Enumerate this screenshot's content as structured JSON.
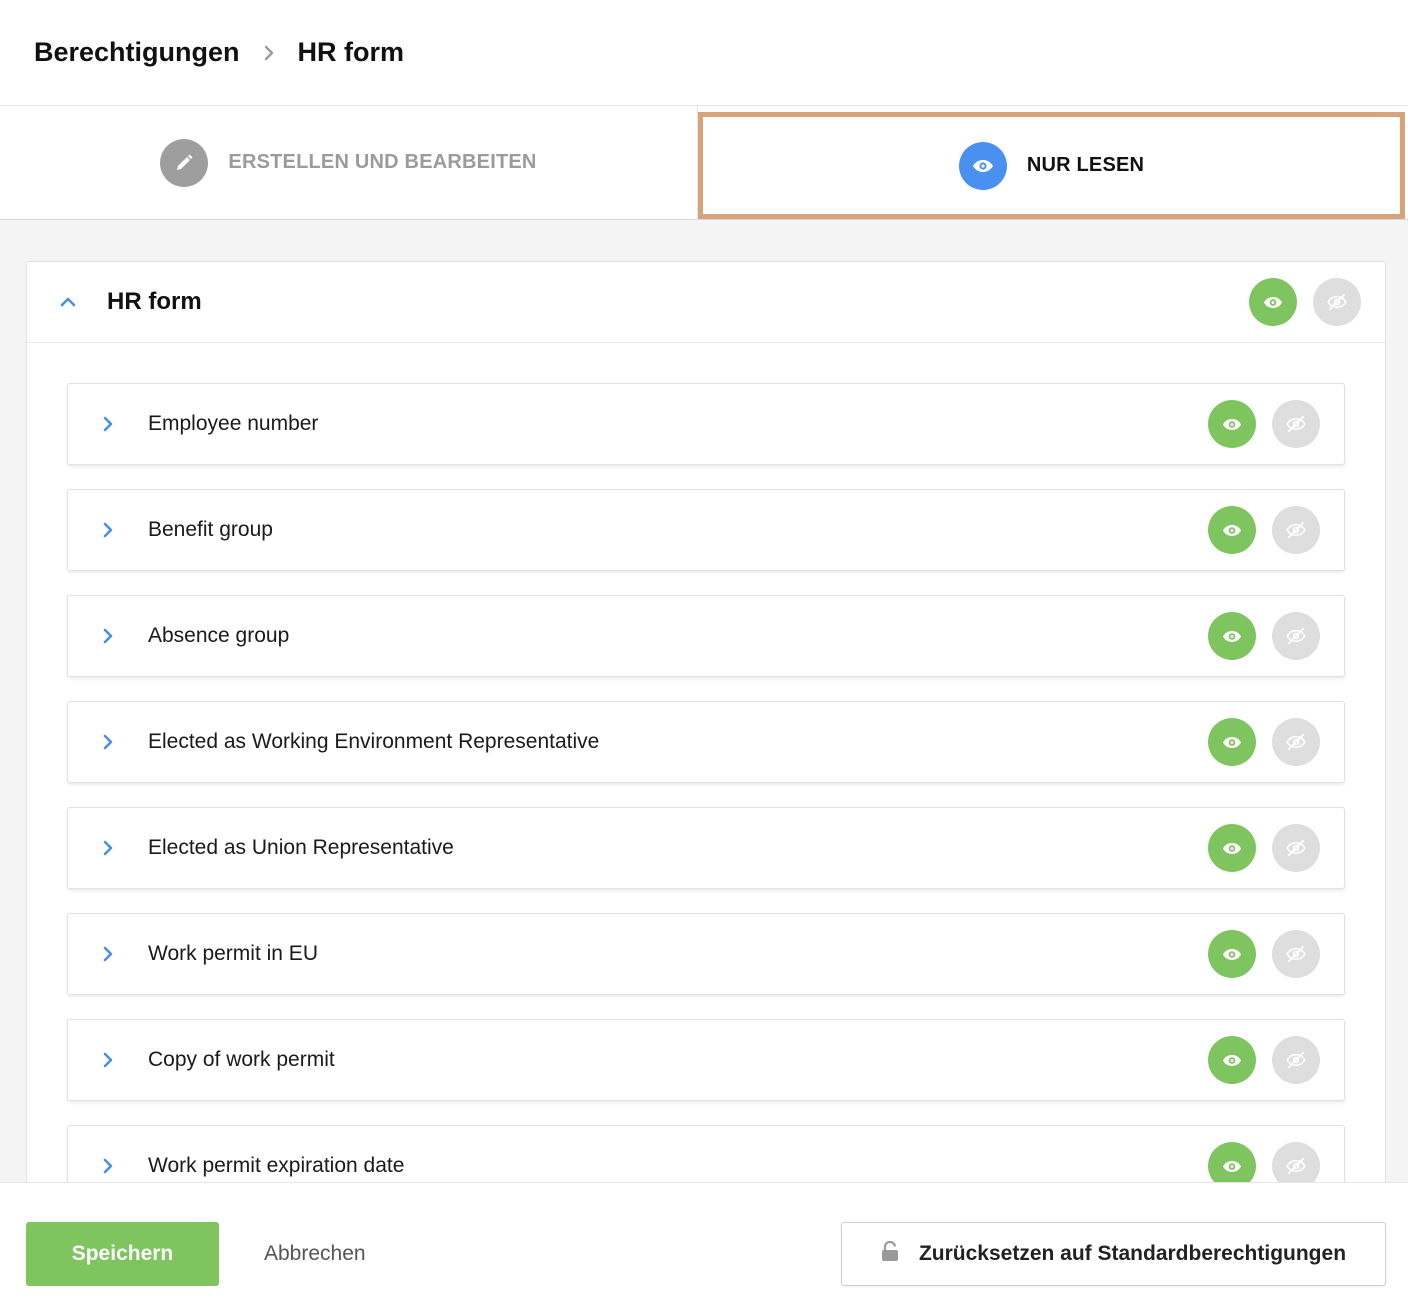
{
  "breadcrumb": {
    "parent": "Berechtigungen",
    "current": "HR form"
  },
  "tabs": [
    {
      "label": "ERSTELLEN UND BEARBEITEN",
      "icon": "pencil-icon",
      "active": false
    },
    {
      "label": "NUR LESEN",
      "icon": "eye-icon",
      "active": true
    }
  ],
  "section": {
    "title": "HR form",
    "expanded": true,
    "visibility": "visible"
  },
  "fields": [
    {
      "label": "Employee number",
      "visibility": "visible"
    },
    {
      "label": "Benefit group",
      "visibility": "visible"
    },
    {
      "label": "Absence group",
      "visibility": "visible"
    },
    {
      "label": "Elected as Working Environment Representative",
      "visibility": "visible"
    },
    {
      "label": "Elected as Union Representative",
      "visibility": "visible"
    },
    {
      "label": "Work permit in EU",
      "visibility": "visible"
    },
    {
      "label": "Copy of work permit",
      "visibility": "visible"
    },
    {
      "label": "Work permit expiration date",
      "visibility": "visible"
    }
  ],
  "footer": {
    "save_label": "Speichern",
    "cancel_label": "Abbrechen",
    "reset_label": "Zurücksetzen auf Standardberechtigungen"
  },
  "colors": {
    "accent_green": "#7ec45f",
    "accent_blue": "#4a90f0",
    "highlight_border": "#d8a27a",
    "chevron_blue": "#4a90e2",
    "inactive_grey": "#dedede"
  }
}
